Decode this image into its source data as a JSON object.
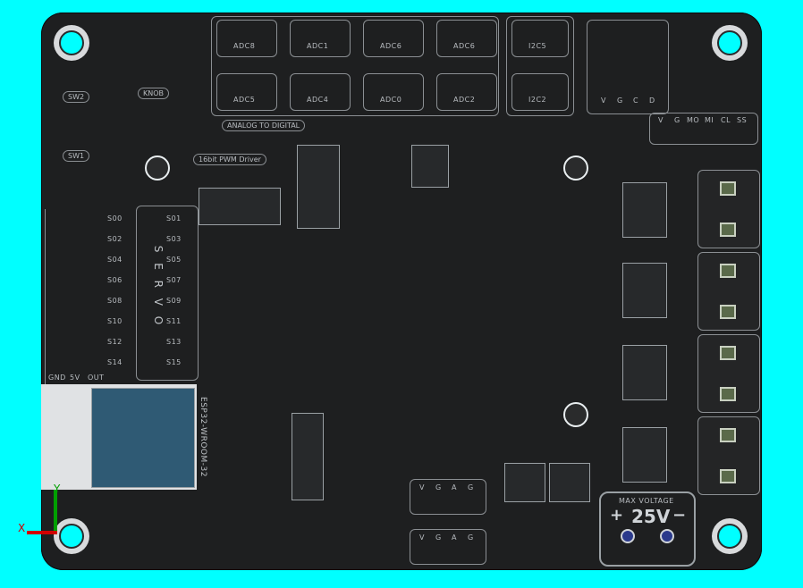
{
  "view": {
    "background_color": "#00ffff",
    "board_color": "#1e1f20",
    "triad": {
      "y_label": "Y",
      "x_label": "X"
    }
  },
  "silkscreen": {
    "adc_top": [
      "ADC8",
      "ADC1",
      "ADC6",
      "ADC6"
    ],
    "adc_bottom": [
      "ADC5",
      "ADC4",
      "ADC0",
      "ADC2"
    ],
    "i2c_labels": [
      "I2C5",
      "I2C2"
    ],
    "vgcd_labels": [
      "V",
      "G",
      "C",
      "D"
    ],
    "top_right_header": [
      "V",
      "G",
      "MO",
      "MI",
      "CL",
      "SS"
    ],
    "sw2": "SW2",
    "sw1": "SW1",
    "knob": "KNOB",
    "analog_to_digital": "ANALOG TO DIGITAL",
    "pwm_driver": "16bit PWM Driver",
    "servo": "S E R V O",
    "servo_left_labels": [
      "S00",
      "S02",
      "S04",
      "S06",
      "S08",
      "S10",
      "S12",
      "S14"
    ],
    "servo_right_labels": [
      "S01",
      "S03",
      "S05",
      "S07",
      "S09",
      "S11",
      "S13",
      "S15"
    ],
    "esp_label": "ESP32-WROOM-32",
    "max_voltage": "MAX VOLTAGE",
    "voltage": "25V",
    "plus": "+",
    "minus": "−",
    "bottom_header_1": [
      "V",
      "G",
      "A",
      "G"
    ],
    "bottom_header_2": [
      "V",
      "G",
      "A",
      "G"
    ],
    "gnd_5v": [
      "GND",
      "5V",
      "OUT"
    ]
  }
}
